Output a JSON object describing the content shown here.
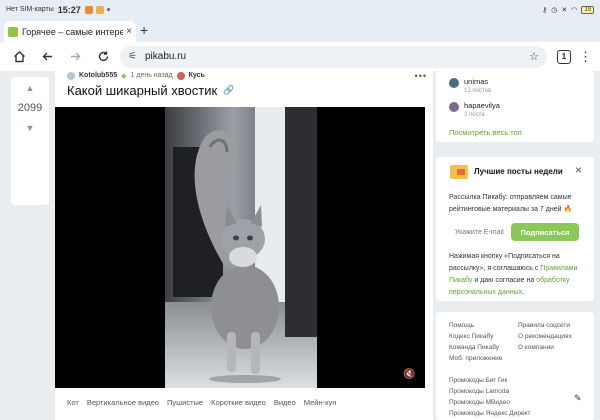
{
  "status_bar": {
    "sim_text": "Нет SIM-карты",
    "time": "15:27",
    "battery": "19"
  },
  "browser": {
    "tab_title": "Горячее – самые интересн",
    "tab_close": "×",
    "new_tab": "+",
    "url": "pikabu.ru",
    "tabs_count": "1"
  },
  "post": {
    "votes": "2099",
    "up_arrow": "▲",
    "down_arrow": "▼",
    "vote_more": "—",
    "author": "Kotolub555",
    "age": "1 день назад",
    "community": "Кусь",
    "menu": "•••",
    "title": "Какой шикарный хвостик",
    "tags": [
      "Кот",
      "Вертикальное видео",
      "Пушистые",
      "Короткие видео",
      "Видео",
      "Мейн-кун"
    ]
  },
  "sidebar": {
    "authors": [
      {
        "name": "unimas",
        "posts": "13 постов",
        "color": "#4f6a7e"
      },
      {
        "name": "hapaevilya",
        "posts": "3 поста",
        "color": "#7a6a8e"
      }
    ],
    "show_all": "Посмотреть весь топ",
    "best": {
      "title": "Лучшие посты недели",
      "close": "×",
      "desc": "Рассылка Пикабу: отправляем самые рейтинговые материалы за 7 дней",
      "fire": "🔥",
      "email_placeholder": "Укажите E-mail",
      "subscribe": "Подписаться",
      "note_1": "Нажимая кнопку «Подписаться на рассылку», я соглашаюсь с ",
      "note_link_1": "Правилами Пикабу",
      "note_2": " и даю согласие на ",
      "note_link_2": "обработку персональных данных",
      "note_3": "."
    },
    "links_col1": [
      "Помощь",
      "Кодекс Пикабу",
      "Команда Пикабу",
      "Моб. приложение"
    ],
    "links_col2": [
      "Правила соцсети",
      "О рекомендациях",
      "О компании"
    ],
    "promo": [
      "Промокоды Биг Гик",
      "Промокоды Lamoda",
      "Промокоды МВидео",
      "Промокоды Яндекс Директ"
    ]
  },
  "colors": {
    "accent_green": "#8ac858",
    "link_green": "#5fa333"
  }
}
